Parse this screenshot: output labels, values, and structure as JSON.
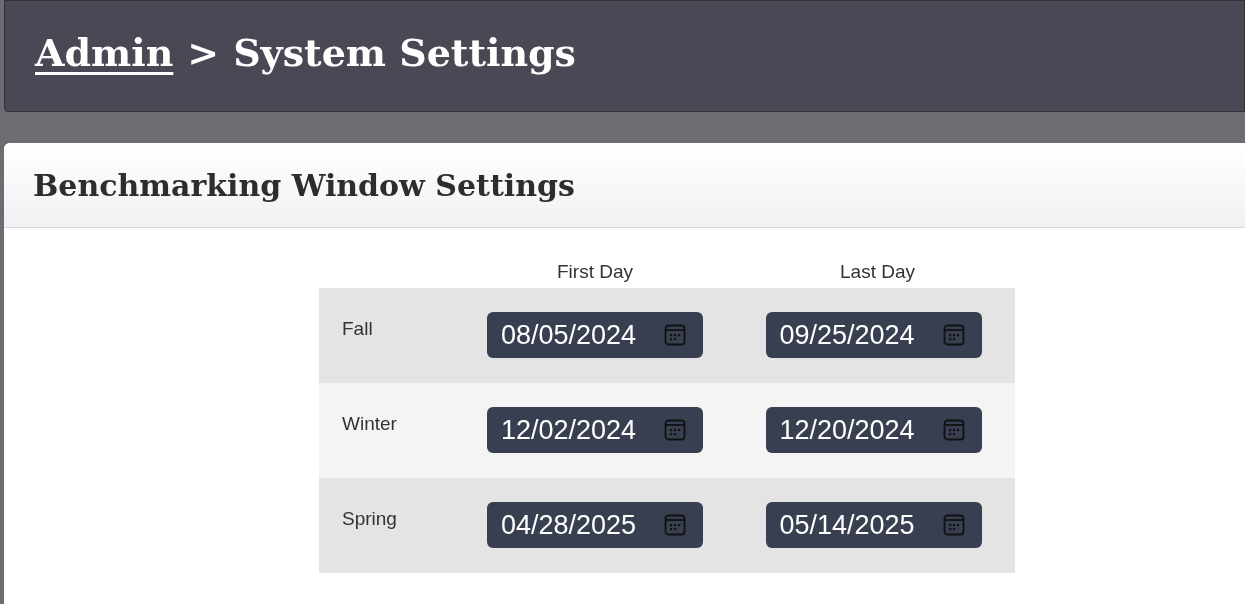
{
  "breadcrumb": {
    "link": "Admin",
    "separator": ">",
    "current": "System Settings"
  },
  "panel": {
    "title": "Benchmarking Window Settings"
  },
  "table": {
    "columns": [
      "First Day",
      "Last Day"
    ],
    "rows": [
      {
        "season": "Fall",
        "first_day": "08/05/2024",
        "last_day": "09/25/2024"
      },
      {
        "season": "Winter",
        "first_day": "12/02/2024",
        "last_day": "12/20/2024"
      },
      {
        "season": "Spring",
        "first_day": "04/28/2025",
        "last_day": "05/14/2025"
      }
    ]
  }
}
